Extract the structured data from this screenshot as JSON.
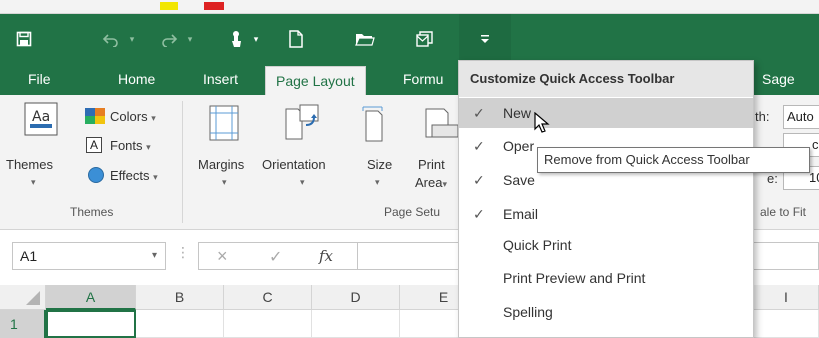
{
  "colors": {
    "accent": "#217346",
    "ribbon_bg": "#f3f3f3",
    "menu_hover": "#d0d0d0"
  },
  "qat": {
    "items": [
      {
        "icon": "save-icon"
      },
      {
        "icon": "undo-icon"
      },
      {
        "icon": "redo-icon"
      },
      {
        "icon": "touch-mode-icon"
      },
      {
        "icon": "new-document-icon"
      },
      {
        "icon": "open-folder-icon"
      },
      {
        "icon": "email-icon"
      },
      {
        "icon": "customize-toolbar-icon"
      }
    ]
  },
  "tabs": [
    "File",
    "Home",
    "Insert",
    "Page Layout",
    "Formu",
    "Sage"
  ],
  "active_tab": "Page Layout",
  "ribbon": {
    "themes_group": {
      "themes_label": "Themes",
      "colors_label": "Colors",
      "fonts_label": "Fonts",
      "effects_label": "Effects",
      "group_label": "Themes"
    },
    "page_setup_group": {
      "margins_label": "Margins",
      "orientation_label": "Orientation",
      "size_label": "Size",
      "print_label": "Print",
      "area_label": "Area",
      "group_label": "Page Setu"
    },
    "scale_group": {
      "width_label": "th:",
      "width_value": "Auto",
      "height_frag": "c",
      "scale_frag": "e:",
      "scale_value": "10",
      "group_label": "ale to Fit"
    }
  },
  "formula_bar": {
    "name_box": "A1",
    "cancel_symbol": "×",
    "enter_symbol": "✓",
    "fx_symbol": "fx"
  },
  "grid": {
    "columns": [
      "A",
      "B",
      "C",
      "D",
      "E",
      "I"
    ],
    "rows": [
      "1"
    ]
  },
  "menu": {
    "title": "Customize Quick Access Toolbar",
    "items": [
      {
        "label": "New",
        "checked": true,
        "hover": true
      },
      {
        "label": "Oper",
        "checked": true
      },
      {
        "label": "Save",
        "checked": true
      },
      {
        "label": "Email",
        "checked": true
      },
      {
        "label": "Quick Print",
        "checked": false
      },
      {
        "label": "Print Preview and Print",
        "checked": false
      },
      {
        "label": "Spelling",
        "checked": false
      }
    ],
    "check_symbol": "✓"
  },
  "tooltip": "Remove from Quick Access Toolbar"
}
